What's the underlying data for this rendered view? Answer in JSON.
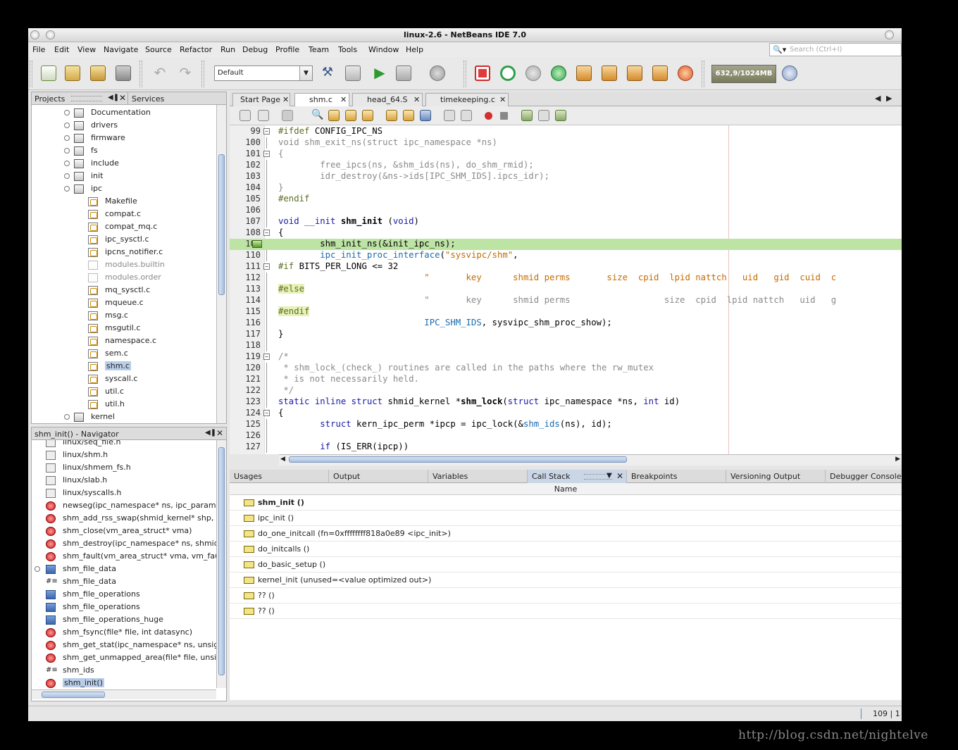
{
  "window": {
    "title": "linux-2.6 - NetBeans IDE 7.0"
  },
  "menu": [
    "File",
    "Edit",
    "View",
    "Navigate",
    "Source",
    "Refactor",
    "Run",
    "Debug",
    "Profile",
    "Team",
    "Tools",
    "Window",
    "Help"
  ],
  "search": {
    "placeholder": "Search (Ctrl+I)"
  },
  "toolbar": {
    "config": "Default",
    "memory": "632,9/1024MB"
  },
  "projects": {
    "tabs": [
      "Projects",
      "Services"
    ],
    "items": [
      {
        "label": "Documentation",
        "type": "folder",
        "level": 0,
        "exp": true
      },
      {
        "label": "drivers",
        "type": "folder",
        "level": 0,
        "exp": true
      },
      {
        "label": "firmware",
        "type": "folder",
        "level": 0,
        "exp": true
      },
      {
        "label": "fs",
        "type": "folder",
        "level": 0,
        "exp": true
      },
      {
        "label": "include",
        "type": "folder",
        "level": 0,
        "exp": true
      },
      {
        "label": "init",
        "type": "folder",
        "level": 0,
        "exp": true
      },
      {
        "label": "ipc",
        "type": "folder",
        "level": 0,
        "exp": true
      },
      {
        "label": "Makefile",
        "type": "make",
        "level": 1
      },
      {
        "label": "compat.c",
        "type": "c",
        "level": 1
      },
      {
        "label": "compat_mq.c",
        "type": "c",
        "level": 1
      },
      {
        "label": "ipc_sysctl.c",
        "type": "c",
        "level": 1
      },
      {
        "label": "ipcns_notifier.c",
        "type": "c",
        "level": 1
      },
      {
        "label": "modules.builtin",
        "type": "blank",
        "level": 1
      },
      {
        "label": "modules.order",
        "type": "blank",
        "level": 1
      },
      {
        "label": "mq_sysctl.c",
        "type": "c",
        "level": 1
      },
      {
        "label": "mqueue.c",
        "type": "c",
        "level": 1
      },
      {
        "label": "msg.c",
        "type": "c",
        "level": 1
      },
      {
        "label": "msgutil.c",
        "type": "c",
        "level": 1
      },
      {
        "label": "namespace.c",
        "type": "c",
        "level": 1
      },
      {
        "label": "sem.c",
        "type": "c",
        "level": 1
      },
      {
        "label": "shm.c",
        "type": "c",
        "level": 1,
        "selected": true
      },
      {
        "label": "syscall.c",
        "type": "c",
        "level": 1
      },
      {
        "label": "util.c",
        "type": "c",
        "level": 1
      },
      {
        "label": "util.h",
        "type": "c",
        "level": 1
      },
      {
        "label": "kernel",
        "type": "folder",
        "level": 0,
        "exp": true
      }
    ]
  },
  "navigator": {
    "title": "shm_init() - Navigator",
    "items": [
      {
        "label": "linux/seq_file.h",
        "icon": "h"
      },
      {
        "label": "linux/shm.h",
        "icon": "h"
      },
      {
        "label": "linux/shmem_fs.h",
        "icon": "h"
      },
      {
        "label": "linux/slab.h",
        "icon": "h"
      },
      {
        "label": "linux/syscalls.h",
        "icon": "h"
      },
      {
        "label": "newseg(ipc_namespace* ns, ipc_params",
        "icon": "f"
      },
      {
        "label": "shm_add_rss_swap(shmid_kernel* shp,",
        "icon": "f"
      },
      {
        "label": "shm_close(vm_area_struct* vma)",
        "icon": "f"
      },
      {
        "label": "shm_destroy(ipc_namespace* ns, shmid",
        "icon": "f"
      },
      {
        "label": "shm_fault(vm_area_struct* vma, vm_fau",
        "icon": "f"
      },
      {
        "label": "shm_file_data",
        "icon": "s",
        "exp": true
      },
      {
        "label": "shm_file_data",
        "icon": "v"
      },
      {
        "label": "shm_file_operations",
        "icon": "s"
      },
      {
        "label": "shm_file_operations",
        "icon": "s"
      },
      {
        "label": "shm_file_operations_huge",
        "icon": "s"
      },
      {
        "label": "shm_fsync(file* file, int datasync)",
        "icon": "f"
      },
      {
        "label": "shm_get_stat(ipc_namespace* ns, unsig",
        "icon": "f"
      },
      {
        "label": "shm_get_unmapped_area(file* file, unsig",
        "icon": "f"
      },
      {
        "label": "shm_ids",
        "icon": "v"
      },
      {
        "label": "shm_init()",
        "icon": "f",
        "selected": true
      }
    ]
  },
  "editor": {
    "tabs": [
      "Start Page",
      "shm.c",
      "head_64.S",
      "timekeeping.c"
    ],
    "active_tab": "shm.c",
    "lines": [
      {
        "n": "99",
        "fold": "-",
        "segs": [
          [
            "#ifdef",
            "#5b6f22"
          ],
          [
            " CONFIG_IPC_NS",
            "#000"
          ]
        ]
      },
      {
        "n": "100",
        "segs": [
          [
            "void shm_exit_ns(struct ipc_namespace *ns)",
            "#8a8a8a"
          ]
        ]
      },
      {
        "n": "101",
        "fold": "-",
        "segs": [
          [
            "{",
            "#8a8a8a"
          ]
        ]
      },
      {
        "n": "102",
        "segs": [
          [
            "        free_ipcs(ns, &shm_ids(ns), do_shm_rmid);",
            "#8a8a8a"
          ]
        ]
      },
      {
        "n": "103",
        "segs": [
          [
            "        idr_destroy(&ns->ids[IPC_SHM_IDS].ipcs_idr);",
            "#8a8a8a"
          ]
        ]
      },
      {
        "n": "104",
        "segs": [
          [
            "}",
            "#8a8a8a"
          ]
        ]
      },
      {
        "n": "105",
        "segs": [
          [
            "#endif",
            "#5b6f22"
          ]
        ]
      },
      {
        "n": "106",
        "segs": []
      },
      {
        "n": "107",
        "segs": [
          [
            "void",
            "#1a1aa6"
          ],
          [
            " ",
            "#000"
          ],
          [
            "__init",
            "#1a1aa6"
          ],
          [
            " ",
            "#000"
          ],
          [
            "shm_init",
            "#000",
            "b"
          ],
          [
            " (",
            "#000"
          ],
          [
            "void",
            "#1a1aa6"
          ],
          [
            ")",
            "#000"
          ]
        ]
      },
      {
        "n": "108",
        "fold": "-",
        "segs": [
          [
            "{",
            "#000"
          ]
        ]
      },
      {
        "n": "109",
        "hl": true,
        "segs": [
          [
            "        shm_init_ns(&init_ipc_ns);",
            "#000"
          ]
        ]
      },
      {
        "n": "110",
        "segs": [
          [
            "        ",
            "#000"
          ],
          [
            "ipc_init_proc_interface",
            "#1a6ab0"
          ],
          [
            "(",
            "#000"
          ],
          [
            "\"sysvipc/shm\"",
            "#c46c00"
          ],
          [
            ",",
            "#000"
          ]
        ]
      },
      {
        "n": "111",
        "fold": "-",
        "segs": [
          [
            "#if",
            "#5b6f22"
          ],
          [
            " BITS_PER_LONG <= 32",
            "#000"
          ]
        ]
      },
      {
        "n": "112",
        "segs": [
          [
            "                            \"       key      shmid perms       size  cpid  lpid nattch   uid   gid  cuid  c",
            "#c46c00"
          ]
        ]
      },
      {
        "n": "113",
        "segs": [
          [
            "#else",
            "#5b6f22"
          ]
        ]
      },
      {
        "n": "114",
        "segs": [
          [
            "                            \"       key      shmid perms                  size  cpid  lpid nattch   uid   g",
            "#8a8a8a"
          ]
        ]
      },
      {
        "n": "115",
        "segs": [
          [
            "#endif",
            "#5b6f22"
          ]
        ]
      },
      {
        "n": "116",
        "segs": [
          [
            "                            ",
            "#000"
          ],
          [
            "IPC_SHM_IDS",
            "#1a6ab0"
          ],
          [
            ", sysvipc_shm_proc_show);",
            "#000"
          ]
        ]
      },
      {
        "n": "117",
        "segs": [
          [
            "}",
            "#000"
          ]
        ]
      },
      {
        "n": "118",
        "segs": []
      },
      {
        "n": "119",
        "fold": "-",
        "segs": [
          [
            "/*",
            "#8a8a8a"
          ]
        ]
      },
      {
        "n": "120",
        "segs": [
          [
            " * shm_lock_(check_) routines are called in the paths where the rw_mutex",
            "#8a8a8a"
          ]
        ]
      },
      {
        "n": "121",
        "segs": [
          [
            " * is not necessarily held.",
            "#8a8a8a"
          ]
        ]
      },
      {
        "n": "122",
        "segs": [
          [
            " */",
            "#8a8a8a"
          ]
        ]
      },
      {
        "n": "123",
        "segs": [
          [
            "static",
            "#1a1aa6"
          ],
          [
            " ",
            "#000"
          ],
          [
            "inline",
            "#1a1aa6"
          ],
          [
            " ",
            "#000"
          ],
          [
            "struct",
            "#1a1aa6"
          ],
          [
            " shmid_kernel *",
            "#000"
          ],
          [
            "shm_lock",
            "#000",
            "b"
          ],
          [
            "(",
            "#000"
          ],
          [
            "struct",
            "#1a1aa6"
          ],
          [
            " ipc_namespace *ns, ",
            "#000"
          ],
          [
            "int",
            "#1a1aa6"
          ],
          [
            " id)",
            "#000"
          ]
        ]
      },
      {
        "n": "124",
        "fold": "-",
        "segs": [
          [
            "{",
            "#000"
          ]
        ]
      },
      {
        "n": "125",
        "segs": [
          [
            "        ",
            "#000"
          ],
          [
            "struct",
            "#1a1aa6"
          ],
          [
            " kern_ipc_perm *ipcp = ipc_lock(&",
            "#000"
          ],
          [
            "shm_ids",
            "#1a6ab0"
          ],
          [
            "(ns), id);",
            "#000"
          ]
        ]
      },
      {
        "n": "126",
        "segs": []
      },
      {
        "n": "127",
        "segs": [
          [
            "        ",
            "#000"
          ],
          [
            "if",
            "#1a1aa6"
          ],
          [
            " (IS_ERR(ipcp))",
            "#000"
          ]
        ]
      }
    ]
  },
  "bottom": {
    "tabs": [
      "Usages",
      "Output",
      "Variables",
      "Call Stack",
      "Breakpoints",
      "Versioning Output",
      "Debugger Console"
    ],
    "active": "Call Stack",
    "column": "Name",
    "frames": [
      "shm_init ()",
      "ipc_init ()",
      "do_one_initcall (fn=0xffffffff818a0e89 <ipc_init>)",
      "do_initcalls ()",
      "do_basic_setup ()",
      "kernel_init (unused=<value optimized out>)",
      "?? ()",
      "?? ()"
    ]
  },
  "status": {
    "position": "109 | 1"
  },
  "watermark": "http://blog.csdn.net/nightelve"
}
